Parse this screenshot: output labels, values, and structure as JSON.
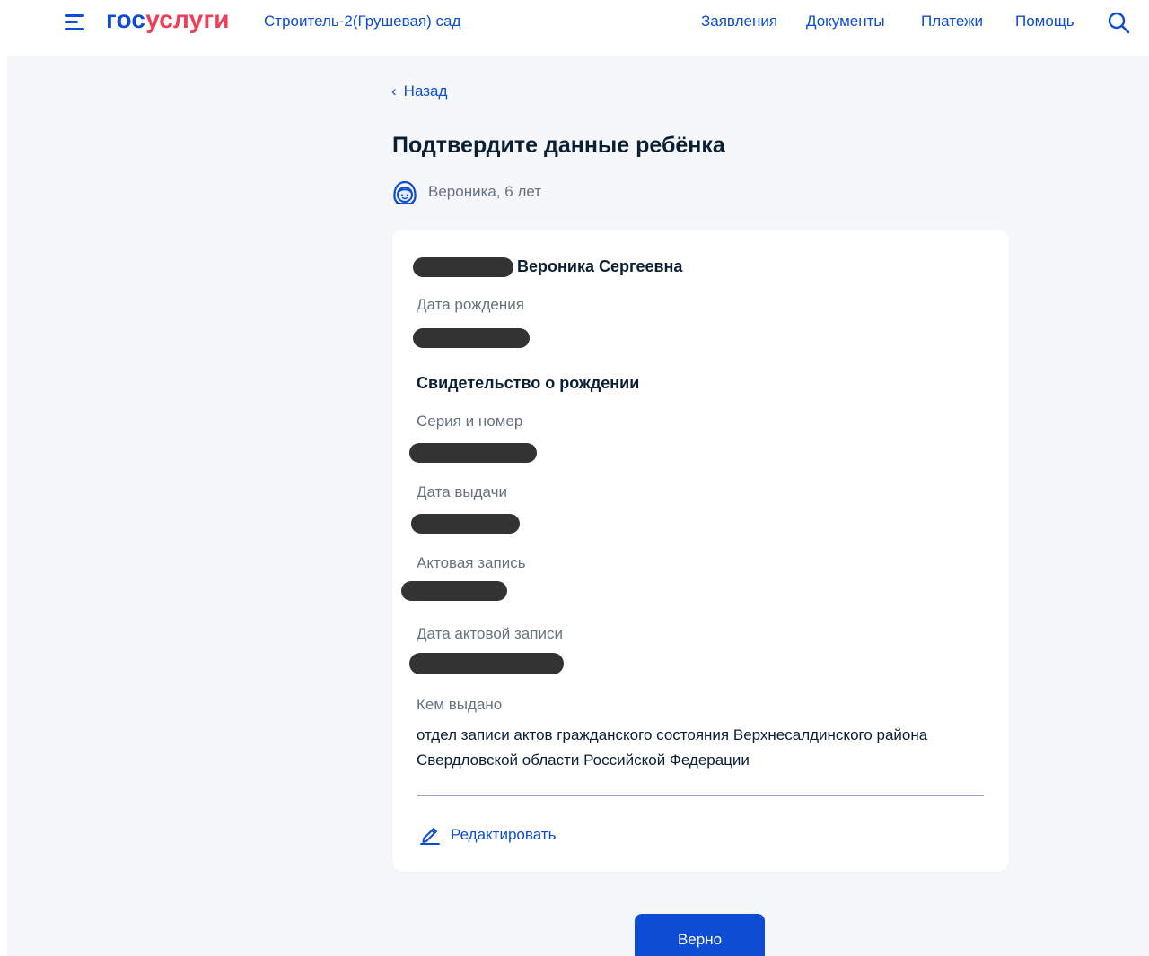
{
  "header": {
    "logo": {
      "part1": "гос",
      "part2": "услуги"
    },
    "location": "Строитель-2(Грушевая) сад",
    "nav": [
      "Заявления",
      "Документы",
      "Платежи",
      "Помощь"
    ],
    "icons": {
      "menu": "burger-menu-icon",
      "search": "search-icon"
    }
  },
  "page": {
    "back_label": "Назад",
    "title": "Подтвердите данные ребёнка",
    "child_label": "Вероника, 6 лет"
  },
  "card": {
    "full_name_visible": "Вероника Сергеевна",
    "birth_date_label": "Дата рождения",
    "certificate_title": "Свидетельство о рождении",
    "series_number_label": "Серия и номер",
    "issue_date_label": "Дата выдачи",
    "act_record_label": "Актовая запись",
    "act_record_date_label": "Дата актовой записи",
    "issued_by_label": "Кем выдано",
    "issued_by_value": "отдел записи актов гражданского состояния Верхнесалдинского района Свердловской области Российской Федерации",
    "edit_label": "Редактировать"
  },
  "actions": {
    "confirm_label": "Верно"
  },
  "colors": {
    "brand_blue": "#0d4cd3",
    "brand_red": "#ee3f58",
    "page_background": "#f5f7fa",
    "text_primary": "#0b1f33",
    "text_secondary": "#66727f",
    "redaction": "#333333"
  }
}
